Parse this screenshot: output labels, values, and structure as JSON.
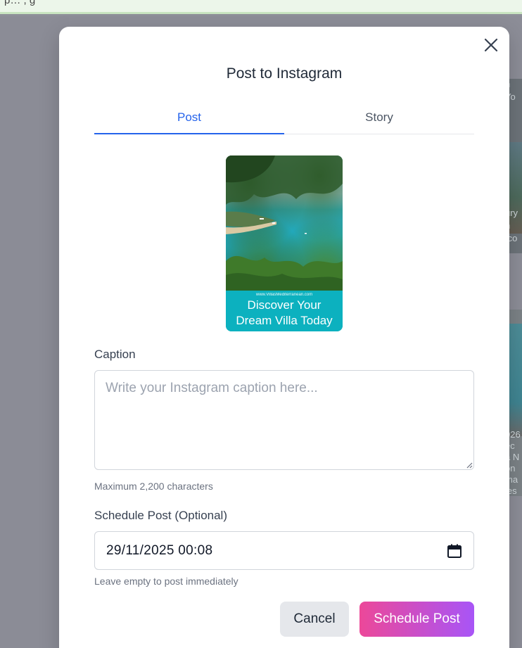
{
  "background": {
    "top_strip_text": "p… , g",
    "card1_lines": [
      "n",
      "Yo",
      "ury",
      "n",
      ".co"
    ],
    "card2_lines": [
      "026",
      "ec",
      "a N",
      "on",
      "ma",
      "ies"
    ]
  },
  "modal": {
    "title": "Post to Instagram",
    "close_icon": "close-icon",
    "tabs": [
      {
        "label": "Post",
        "active": true
      },
      {
        "label": "Story",
        "active": false
      }
    ],
    "preview": {
      "site": "www.VillasMediterranean.com",
      "headline_line1": "Discover Your",
      "headline_line2": "Dream Villa Today"
    },
    "caption": {
      "label": "Caption",
      "value": "",
      "placeholder": "Write your Instagram caption here...",
      "helper": "Maximum 2,200 characters"
    },
    "schedule": {
      "label": "Schedule Post (Optional)",
      "value": "29/11/2025 00:08",
      "helper": "Leave empty to post immediately",
      "icon": "calendar-icon"
    },
    "buttons": {
      "cancel": "Cancel",
      "submit": "Schedule Post"
    }
  },
  "colors": {
    "accent": "#2563eb",
    "submit_gradient_start": "#ec4899",
    "submit_gradient_end": "#a855f7",
    "preview_band": "#0cb1bf"
  }
}
